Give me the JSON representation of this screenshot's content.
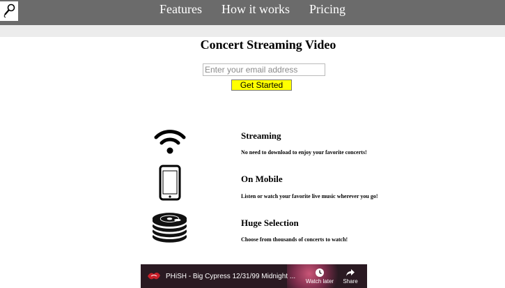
{
  "nav": {
    "links": [
      "Features",
      "How it works",
      "Pricing"
    ]
  },
  "hero": {
    "headline": "Concert Streaming Video",
    "email_placeholder": "Enter your email address",
    "cta_label": "Get Started"
  },
  "features": [
    {
      "icon": "wifi-icon",
      "title": "Streaming",
      "desc": "No need to download to enjoy your favorite concerts!"
    },
    {
      "icon": "phone-icon",
      "title": "On Mobile",
      "desc": "Listen or watch your favorite live music wherever you go!"
    },
    {
      "icon": "disc-stack-icon",
      "title": "Huge Selection",
      "desc": "Choose from thousands of concerts to watch!"
    }
  ],
  "video": {
    "title": "PHiSH - Big Cypress 12/31/99 Midnight ...",
    "watch_later_label": "Watch later",
    "share_label": "Share"
  },
  "colors": {
    "navbar": "#6b6b6b",
    "subbar": "#ececec",
    "cta_bg": "#ffff00"
  }
}
